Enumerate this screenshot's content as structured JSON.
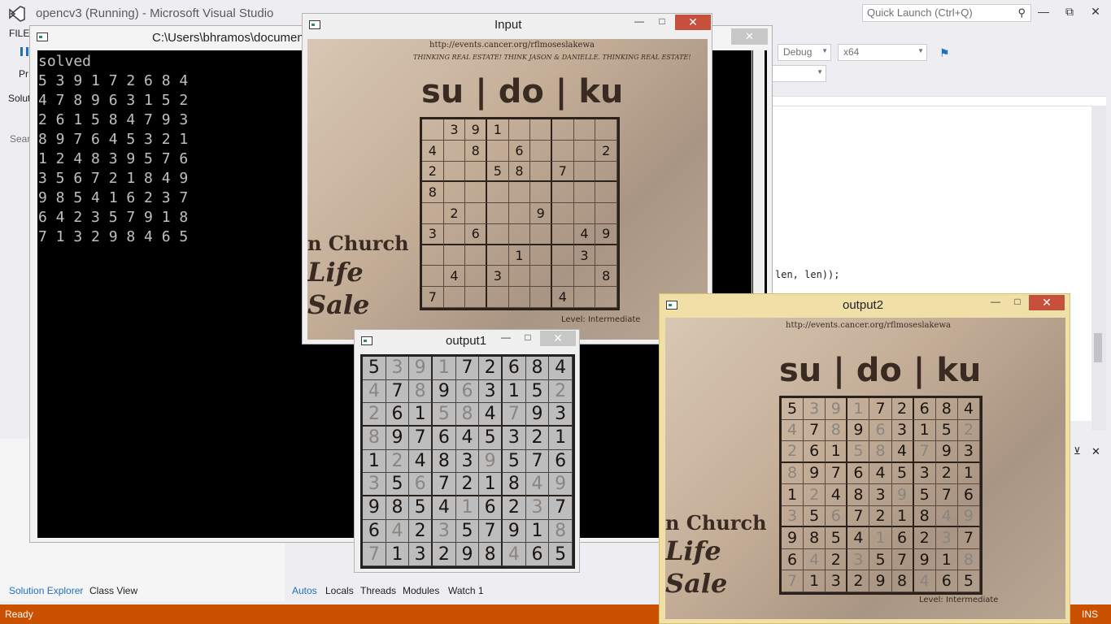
{
  "vs": {
    "title": "opencv3 (Running) - Microsoft Visual Studio",
    "quick_launch": "Quick Launch (Ctrl+Q)",
    "menu_file": "FILE",
    "side_label1": "Pr",
    "side_label2": "Soluti",
    "search_label": "Searc",
    "config": "Debug",
    "platform": "x64",
    "code_fragment": "len, len));",
    "bottom_tabs_left": [
      "Solution Explorer",
      "Class View"
    ],
    "bottom_tabs_right": [
      "Autos",
      "Locals",
      "Threads",
      "Modules",
      "Watch 1"
    ],
    "status_ready": "Ready",
    "status_ins": "INS",
    "accent": "#ca5100"
  },
  "console": {
    "title": "C:\\Users\\bhramos\\documen",
    "heading": "solved",
    "lines": [
      "5 3 9 1 7 2 6 8 4",
      "4 7 8 9 6 3 1 5 2",
      "2 6 1 5 8 4 7 9 3",
      "8 9 7 6 4 5 3 2 1",
      "1 2 4 8 3 9 5 7 6",
      "3 5 6 7 2 1 8 4 9",
      "9 8 5 4 1 6 2 3 7",
      "6 4 2 3 5 7 9 1 8",
      "7 1 3 2 9 8 4 6 5"
    ]
  },
  "input_win": {
    "title": "Input",
    "url": "http://events.cancer.org/rflmoseslakewa",
    "heading": "su | do | ku",
    "banner": "THINKING REAL ESTATE! THINK JASON & DANIELLE. THINKING REAL ESTATE!",
    "church1": "n Church",
    "church2": "Life",
    "church3": "Sale",
    "level": "Level: Intermediate",
    "grid": [
      [
        "",
        "3",
        "9",
        "1",
        "",
        "",
        "",
        "",
        ""
      ],
      [
        "4",
        "",
        "8",
        "",
        "6",
        "",
        "",
        "",
        "2"
      ],
      [
        "2",
        "",
        "",
        "5",
        "8",
        "",
        "7",
        "",
        ""
      ],
      [
        "8",
        "",
        "",
        "",
        "",
        "",
        "",
        "",
        ""
      ],
      [
        "",
        "2",
        "",
        "",
        "",
        "9",
        "",
        "",
        ""
      ],
      [
        "3",
        "",
        "6",
        "",
        "",
        "",
        "",
        "4",
        "9"
      ],
      [
        "",
        "",
        "",
        "",
        "1",
        "",
        "",
        "3",
        ""
      ],
      [
        "",
        "4",
        "",
        "3",
        "",
        "",
        "",
        "",
        "8"
      ],
      [
        "7",
        "",
        "",
        "",
        "",
        "",
        "4",
        "",
        ""
      ]
    ]
  },
  "output1_win": {
    "title": "output1"
  },
  "output2_win": {
    "title": "output2",
    "url": "http://events.cancer.org/rflmoseslakewa",
    "heading": "su | do | ku",
    "church1": "n Church",
    "church2": "Life",
    "church3": "Sale",
    "level": "Level: Intermediate"
  },
  "solution": [
    [
      5,
      3,
      9,
      1,
      7,
      2,
      6,
      8,
      4
    ],
    [
      4,
      7,
      8,
      9,
      6,
      3,
      1,
      5,
      2
    ],
    [
      2,
      6,
      1,
      5,
      8,
      4,
      7,
      9,
      3
    ],
    [
      8,
      9,
      7,
      6,
      4,
      5,
      3,
      2,
      1
    ],
    [
      1,
      2,
      4,
      8,
      3,
      9,
      5,
      7,
      6
    ],
    [
      3,
      5,
      6,
      7,
      2,
      1,
      8,
      4,
      9
    ],
    [
      9,
      8,
      5,
      4,
      1,
      6,
      2,
      3,
      7
    ],
    [
      6,
      4,
      2,
      3,
      5,
      7,
      9,
      1,
      8
    ],
    [
      7,
      1,
      3,
      2,
      9,
      8,
      4,
      6,
      5
    ]
  ]
}
